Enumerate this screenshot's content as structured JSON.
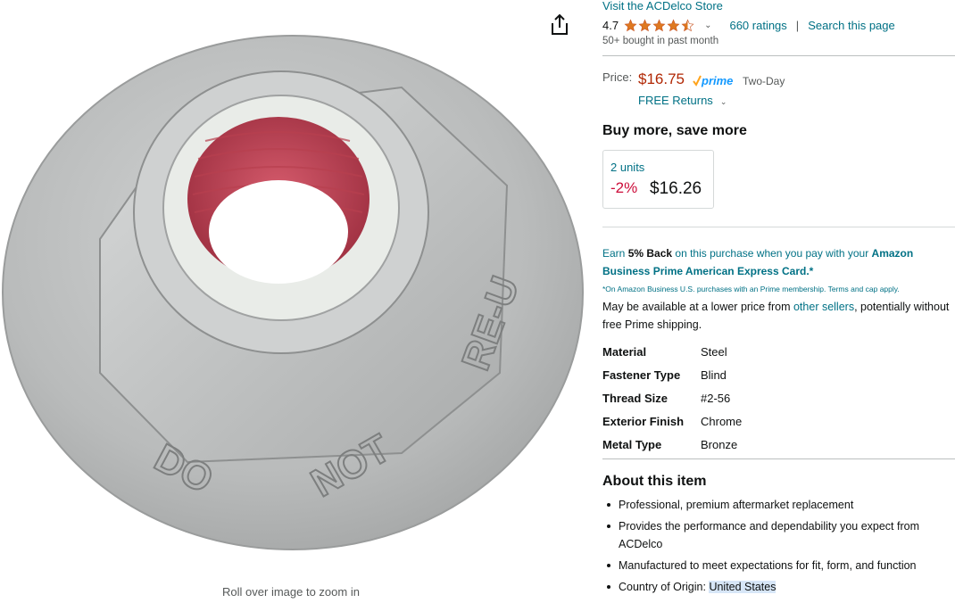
{
  "image": {
    "stamp_text": "DO NOT RE-USE",
    "zoom_hint": "Roll over image to zoom in"
  },
  "store": {
    "link": "Visit the ACDelco Store"
  },
  "rating": {
    "value": "4.7",
    "stars_filled": 4.5,
    "ratings_link": "660 ratings",
    "separator": "|",
    "search_link": "Search this page"
  },
  "bought": "50+ bought in past month",
  "price": {
    "label": "Price:",
    "value": "$16.75",
    "prime_label": "prime",
    "prime_speed": "Two-Day",
    "free_returns": "FREE Returns"
  },
  "buy_more": {
    "title": "Buy more, save more",
    "tier": {
      "units": "2 units",
      "discount": "-2%",
      "price": "$16.26"
    }
  },
  "promo": {
    "earn": "Earn ",
    "back": "5% Back",
    "mid": " on this purchase when you pay with your ",
    "card": "Amazon Business Prime American Express Card.*",
    "fine": "*On Amazon Business U.S. purchases with an Prime membership. Terms and cap apply."
  },
  "lower_price": {
    "before": "May be available at a lower price from ",
    "link": "other sellers",
    "after": ", potentially without free Prime shipping."
  },
  "specs": [
    {
      "key": "Material",
      "value": "Steel"
    },
    {
      "key": "Fastener Type",
      "value": "Blind"
    },
    {
      "key": "Thread Size",
      "value": "#2-56"
    },
    {
      "key": "Exterior Finish",
      "value": "Chrome"
    },
    {
      "key": "Metal Type",
      "value": "Bronze"
    }
  ],
  "about": {
    "title": "About this item",
    "bullets": [
      "Professional, premium aftermarket replacement",
      "Provides the performance and dependability you expect from ACDelco",
      "Manufactured to meet expectations for fit, form, and function"
    ],
    "origin_label": "Country of Origin: ",
    "origin_value": "United States"
  },
  "colors": {
    "link": "#007185",
    "price": "#b12704",
    "discount": "#cc0c39",
    "star": "#de7921"
  },
  "icons": {
    "share": "share-icon",
    "chevron": "chevron-down-icon",
    "star": "star-icon"
  }
}
